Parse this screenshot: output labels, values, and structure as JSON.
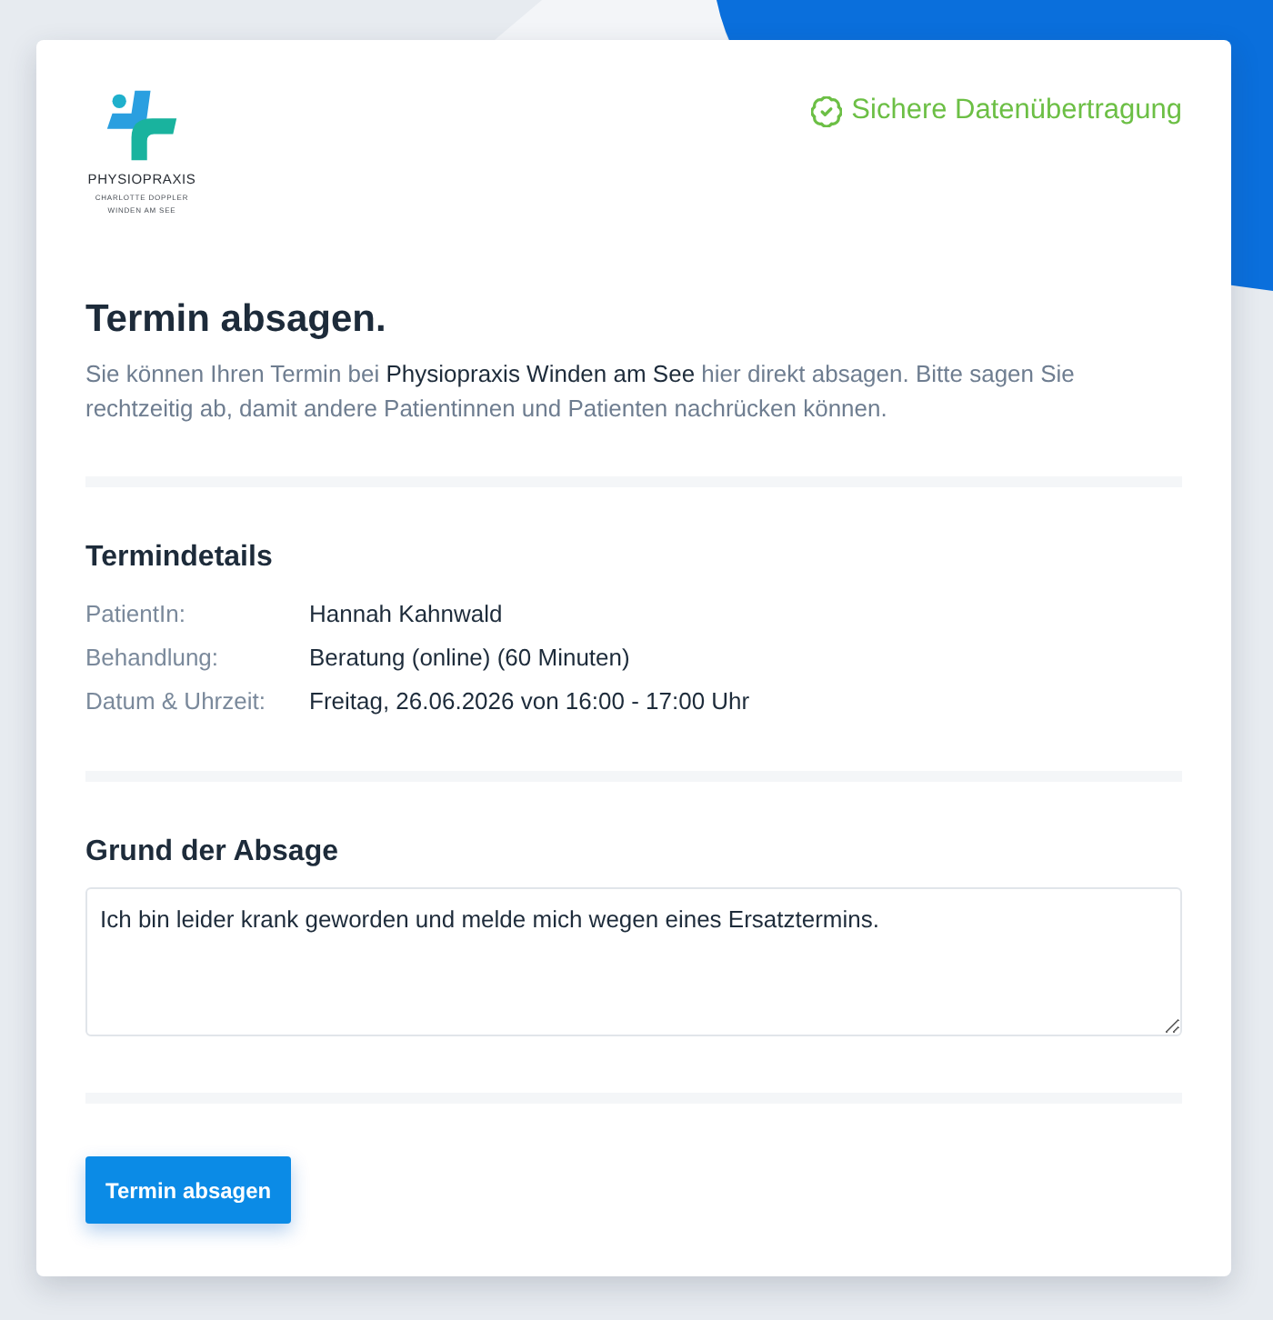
{
  "header": {
    "logo": {
      "name": "PHYSIOPRAXIS",
      "subline_1": "CHARLOTTE DOPPLER",
      "subline_2": "WINDEN AM SEE"
    },
    "security_badge": "Sichere Datenübertragung"
  },
  "intro": {
    "title": "Termin absagen.",
    "text": "Sie können Ihren Termin bei **Physiopraxis Winden am See** hier direkt absagen. Bitte sagen Sie rechtzeitig ab, damit andere Patientinnen und Patienten nachrücken können."
  },
  "details": {
    "title": "Termindetails",
    "rows": [
      {
        "label": "PatientIn:",
        "value": "Hannah Kahnwald"
      },
      {
        "label": "Behandlung:",
        "value": "Beratung (online) (60 Minuten)"
      },
      {
        "label": "Datum & Uhrzeit:",
        "value": "Freitag, 26.06.2026 von 16:00 - 17:00 Uhr"
      }
    ]
  },
  "reason": {
    "title": "Grund der Absage",
    "value": "Ich bin leider krank geworden und melde mich wegen eines Ersatztermins."
  },
  "submit_button": "Termin absagen"
}
